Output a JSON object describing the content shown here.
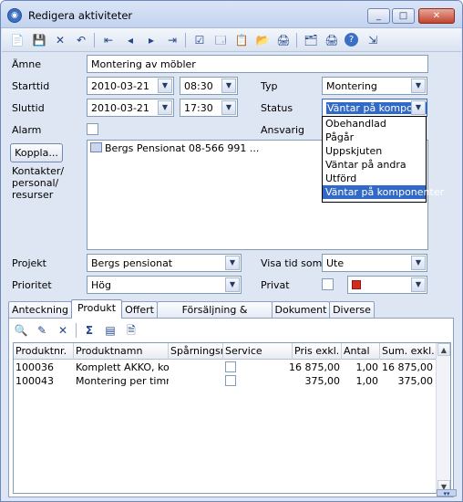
{
  "window": {
    "title": "Redigera aktiviteter",
    "min": "_",
    "max": "□",
    "close": "✕"
  },
  "toolbar": {
    "icons": [
      "📄",
      "💾",
      "✕",
      "↶",
      "⇤",
      "◂",
      "▸",
      "⇥",
      "☑",
      "🗔",
      "📋",
      "📂",
      "🖨",
      "🗂",
      "🖨",
      "?",
      "⇲"
    ]
  },
  "form": {
    "amne_label": "Ämne",
    "amne_value": "Montering av möbler",
    "starttid_label": "Starttid",
    "start_date": "2010-03-21",
    "start_time": "08:30",
    "sluttid_label": "Sluttid",
    "end_date": "2010-03-21",
    "end_time": "17:30",
    "typ_label": "Typ",
    "typ_value": "Montering",
    "status_label": "Status",
    "status_value": "Väntar på kompone",
    "alarm_label": "Alarm",
    "ansvarig_label": "Ansvarig",
    "koppla_button": "Koppla...",
    "kontakter_label_1": "Kontakter/",
    "kontakter_label_2": "personal/",
    "kontakter_label_3": "resurser",
    "contact_entry": "Bergs Pensionat 08-566 991 ...",
    "projekt_label": "Projekt",
    "projekt_value": "Bergs pensionat",
    "visa_tid_label": "Visa tid som",
    "visa_tid_value": "Ute",
    "prioritet_label": "Prioritet",
    "prioritet_value": "Hög",
    "privat_label": "Privat",
    "color_accent": "#d42b1e"
  },
  "status_dropdown": {
    "options": [
      "Obehandlad",
      "Pågår",
      "Uppskjuten",
      "Väntar på andra",
      "Utförd",
      "Väntar på komponenter"
    ],
    "selected_index": 5
  },
  "tabs": [
    "Anteckning",
    "Produkt",
    "Offert",
    "Försäljning & fakturering",
    "Dokument",
    "Diverse"
  ],
  "active_tab": "Produkt",
  "product_toolbar": {
    "icons": [
      "🔍",
      "✎",
      "✕",
      "Σ",
      "▤",
      "🗎"
    ]
  },
  "product_table": {
    "headers": [
      "Produktnr.",
      "Produktnamn",
      "Spårningsnr.",
      "Service",
      "Pris exkl. moms",
      "Antal",
      "Sum. exkl. m"
    ],
    "rows": [
      [
        "100036",
        "Komplett AKKO, kon",
        "",
        "",
        "16 875,00",
        "1,00",
        "16 875,00"
      ],
      [
        "100043",
        "Montering per timme",
        "",
        "",
        "375,00",
        "1,00",
        "375,00"
      ]
    ]
  }
}
